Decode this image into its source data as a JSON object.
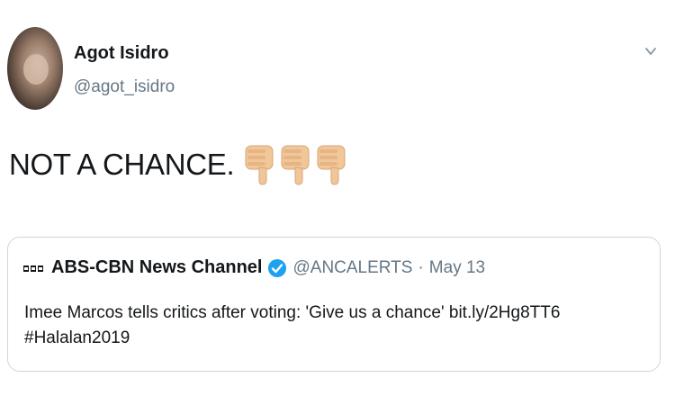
{
  "tweet": {
    "author_name": "Agot Isidro",
    "author_handle": "@agot_isidro",
    "text": "NOT A CHANCE.",
    "emoji_icons": [
      "thumbs-down-icon",
      "thumbs-down-icon",
      "thumbs-down-icon"
    ],
    "quoted": {
      "name": "ABS-CBN News Channel",
      "handle": "@ANCALERTS",
      "separator": "·",
      "date": "May 13",
      "text_line1": "Imee Marcos tells critics after voting: 'Give us a chance' bit.ly/2Hg8TT6",
      "text_line2": "#Halalan2019"
    }
  },
  "colors": {
    "text": "#14171a",
    "muted": "#657786",
    "border": "#ccd6dd",
    "verified": "#1da1f2",
    "thumb": "#f1c79a"
  }
}
